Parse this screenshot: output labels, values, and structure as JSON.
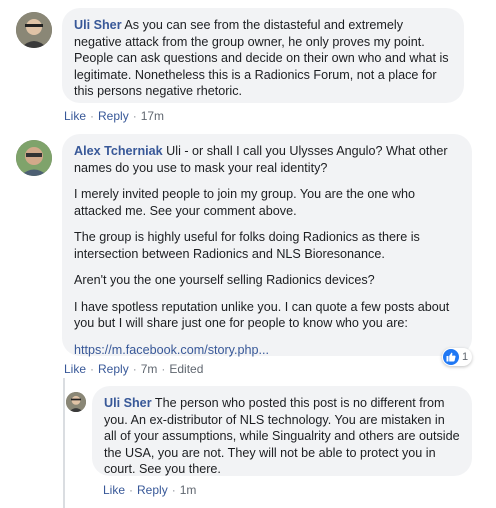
{
  "comments": [
    {
      "author": "Uli Sher",
      "text": "As you can see from the distasteful and extremely negative attack from the group owner, he only proves my point. People can ask questions and decide on their own who and what is legitimate. Nonetheless this is a Radionics Forum, not a place for this persons negative rhetoric.",
      "actions": {
        "like": "Like",
        "reply": "Reply",
        "time": "17m"
      }
    },
    {
      "author": "Alex Tcherniak",
      "lead": "Uli - or shall I call you Ulysses Angulo? What other names do you use to mask your real identity?",
      "paragraphs": [
        "I merely invited people to join my group. You are the one who attacked me. See your comment above.",
        "The group is highly useful for folks doing Radionics as there is intersection between Radionics and NLS Bioresonance.",
        "Aren't you the one yourself selling Radionics devices?",
        "I have spotless reputation unlike you. I can quote a few posts about you but I will share just one for people to know who you are:"
      ],
      "link": "https://m.facebook.com/story.php...",
      "actions": {
        "like": "Like",
        "reply": "Reply",
        "time": "7m",
        "edited": "Edited"
      },
      "reactions": {
        "icon": "like-thumb",
        "count": "1",
        "color": "#2078f4"
      }
    },
    {
      "author": "Uli Sher",
      "text": "The person who posted this post is no different from you. An ex-distributor of NLS technology. You are mistaken in all of your assumptions, while Singualrity and others are outside the USA, you are not. They will not be able to protect you in court. See you there.",
      "actions": {
        "like": "Like",
        "reply": "Reply",
        "time": "1m"
      }
    }
  ],
  "colors": {
    "link": "#385898",
    "bubble": "#f2f3f5",
    "meta": "#606770"
  }
}
